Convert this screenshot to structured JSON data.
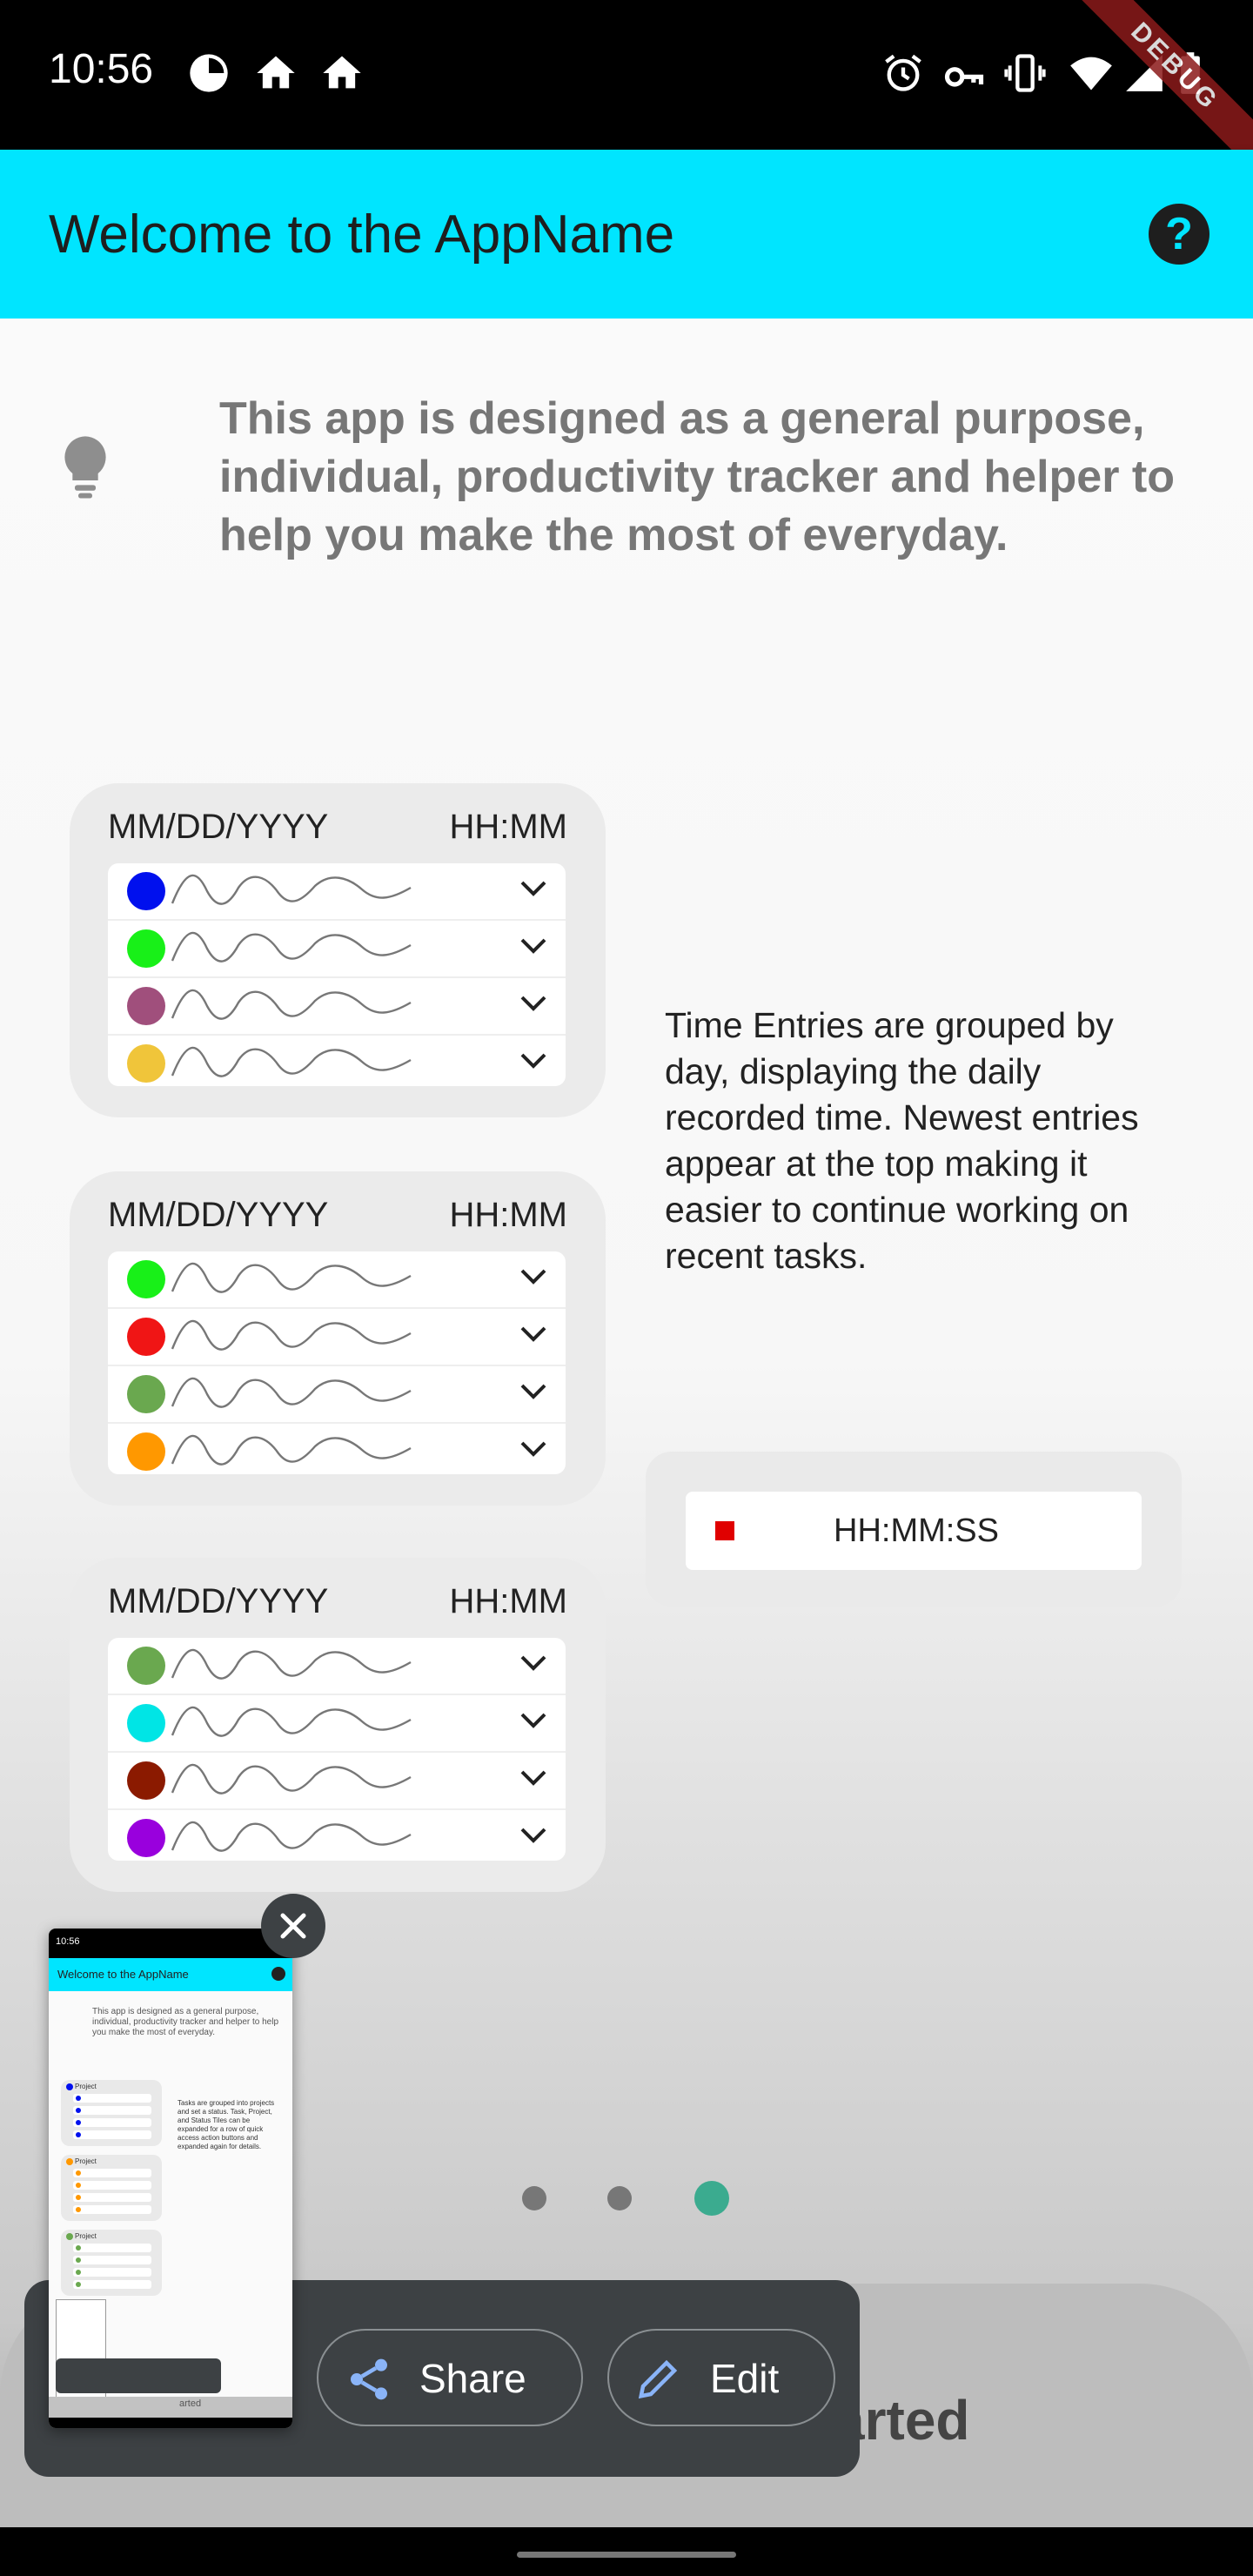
{
  "status_bar": {
    "time": "10:56",
    "left_icons": [
      "data-saver-icon",
      "home-icon",
      "home-icon"
    ],
    "right_icons": [
      "alarm-icon",
      "vpn-key-icon",
      "vibrate-icon",
      "wifi-icon",
      "signal-icon",
      "battery-icon"
    ],
    "debug_banner": "DEBUG"
  },
  "app_bar": {
    "title": "Welcome to the AppName",
    "help_icon": "help-icon",
    "help_symbol": "?",
    "color": "#00e5ff"
  },
  "intro": {
    "icon": "lightbulb-icon",
    "text": "This app is designed as a general purpose, individual, productivity tracker and helper to help you make the most of everyday."
  },
  "illustration": {
    "days": [
      {
        "date": "MM/DD/YYYY",
        "hours": "HH:MM",
        "entry_colors": [
          "#0010ee",
          "#18f018",
          "#a04f7c",
          "#f0c53a"
        ]
      },
      {
        "date": "MM/DD/YYYY",
        "hours": "HH:MM",
        "entry_colors": [
          "#18f018",
          "#f01515",
          "#6aa84f",
          "#ff9800"
        ]
      },
      {
        "date": "MM/DD/YYYY",
        "hours": "HH:MM",
        "entry_colors": [
          "#6aa84f",
          "#00e5e5",
          "#8b1a00",
          "#9900dd"
        ]
      }
    ],
    "description": "Time Entries are grouped by day, displaying the daily recorded time. Newest entries appear at the top making it easier to continue working on recent tasks.",
    "timer": {
      "label": "HH:MM:SS",
      "stop_color": "#e00000"
    }
  },
  "pager": {
    "count": 3,
    "active_index": 2,
    "active_color": "#3bab8f",
    "inactive_color": "#777777"
  },
  "bottom": {
    "get_started": "arted"
  },
  "share_toolbar": {
    "share_label": "Share",
    "share_icon": "share-icon",
    "edit_label": "Edit",
    "edit_icon": "pencil-icon"
  },
  "screenshot_preview": {
    "close_icon": "close-icon",
    "status_time": "10:56",
    "title": "Welcome to the AppName",
    "intro": "This app is designed as a general purpose, individual, productivity tracker and helper to help you make the most of everyday.",
    "project_label": "Project",
    "description": "Tasks are grouped into projects and set a status. Task, Project, and Status Tiles can be expanded for a row of quick access action buttons and expanded again for details.",
    "bottom_text": "arted"
  }
}
